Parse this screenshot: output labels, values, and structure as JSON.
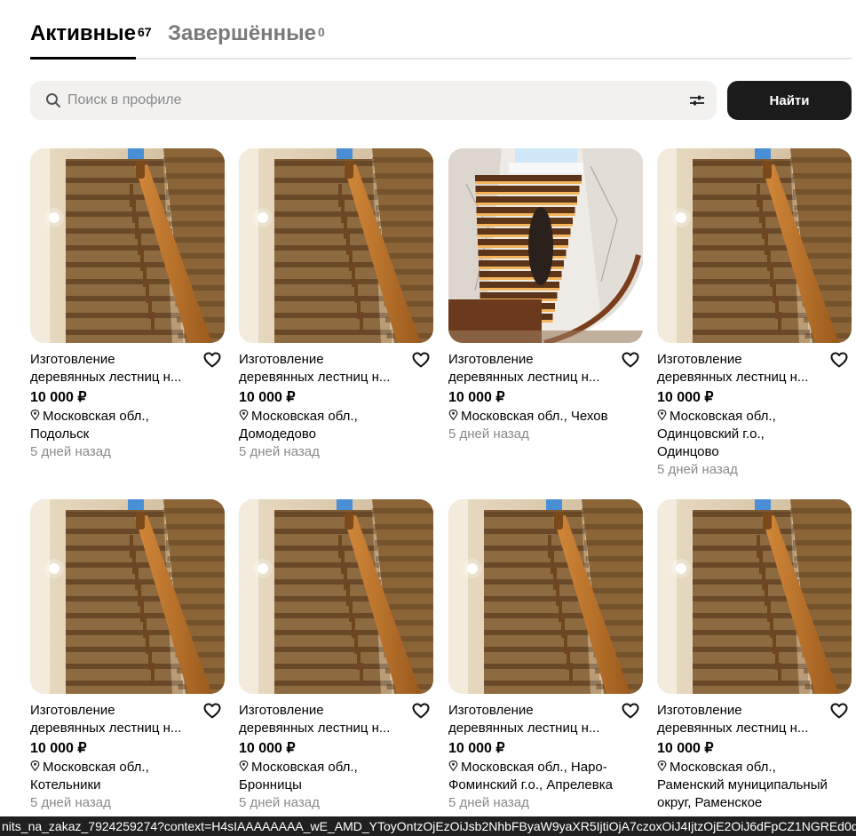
{
  "tabs": {
    "active": {
      "label": "Активные",
      "count": "67"
    },
    "completed": {
      "label": "Завершённые",
      "count": "0"
    }
  },
  "search": {
    "placeholder": "Поиск в профиле",
    "value": "",
    "button_label": "Найти"
  },
  "listings": [
    {
      "title_line1": "Изготовление",
      "title_line2": "деревянных лестниц н...",
      "price": "10 000 ₽",
      "location_lines": [
        "Московская обл.,",
        "Подольск"
      ],
      "date": "5 дней назад",
      "image": "wood-stair"
    },
    {
      "title_line1": "Изготовление",
      "title_line2": "деревянных лестниц н...",
      "price": "10 000 ₽",
      "location_lines": [
        "Московская обл.,",
        "Домодедово"
      ],
      "date": "5 дней назад",
      "image": "wood-stair"
    },
    {
      "title_line1": "Изготовление",
      "title_line2": "деревянных лестниц н...",
      "price": "10 000 ₽",
      "location_lines": [
        "Московская обл., Чехов"
      ],
      "date": "5 дней назад",
      "image": "spiral-stair"
    },
    {
      "title_line1": "Изготовление",
      "title_line2": "деревянных лестниц н...",
      "price": "10 000 ₽",
      "location_lines": [
        "Московская обл.,",
        "Одинцовский г.о.,",
        "Одинцово"
      ],
      "date": "5 дней назад",
      "image": "wood-stair"
    },
    {
      "title_line1": "Изготовление",
      "title_line2": "деревянных лестниц н...",
      "price": "10 000 ₽",
      "location_lines": [
        "Московская обл.,",
        "Котельники"
      ],
      "date": "5 дней назад",
      "image": "wood-stair"
    },
    {
      "title_line1": "Изготовление",
      "title_line2": "деревянных лестниц н...",
      "price": "10 000 ₽",
      "location_lines": [
        "Московская обл.,",
        "Бронницы"
      ],
      "date": "5 дней назад",
      "image": "wood-stair"
    },
    {
      "title_line1": "Изготовление",
      "title_line2": "деревянных лестниц н...",
      "price": "10 000 ₽",
      "location_lines": [
        "Московская обл., Наро-",
        "Фоминский г.о., Апрелевка"
      ],
      "date": "5 дней назад",
      "image": "wood-stair"
    },
    {
      "title_line1": "Изготовление",
      "title_line2": "деревянных лестниц н...",
      "price": "10 000 ₽",
      "location_lines": [
        "Московская обл.,",
        "Раменский муниципальный",
        "округ, Раменское"
      ],
      "date": "",
      "image": "wood-stair"
    }
  ],
  "status_url": "nits_na_zakaz_7924259274?context=H4sIAAAAAAAA_wE_AMD_YToyOntzOjEzOiJsb2NhbFByaW9yaXR5IjtiOjA7czoxOiJ4IjtzOjE2OiJ6dFpCZ1NGREd0d2pWUk",
  "icons": {
    "search": "search-icon",
    "filter": "sliders-icon",
    "favorite": "heart-icon",
    "location": "map-pin-icon"
  }
}
